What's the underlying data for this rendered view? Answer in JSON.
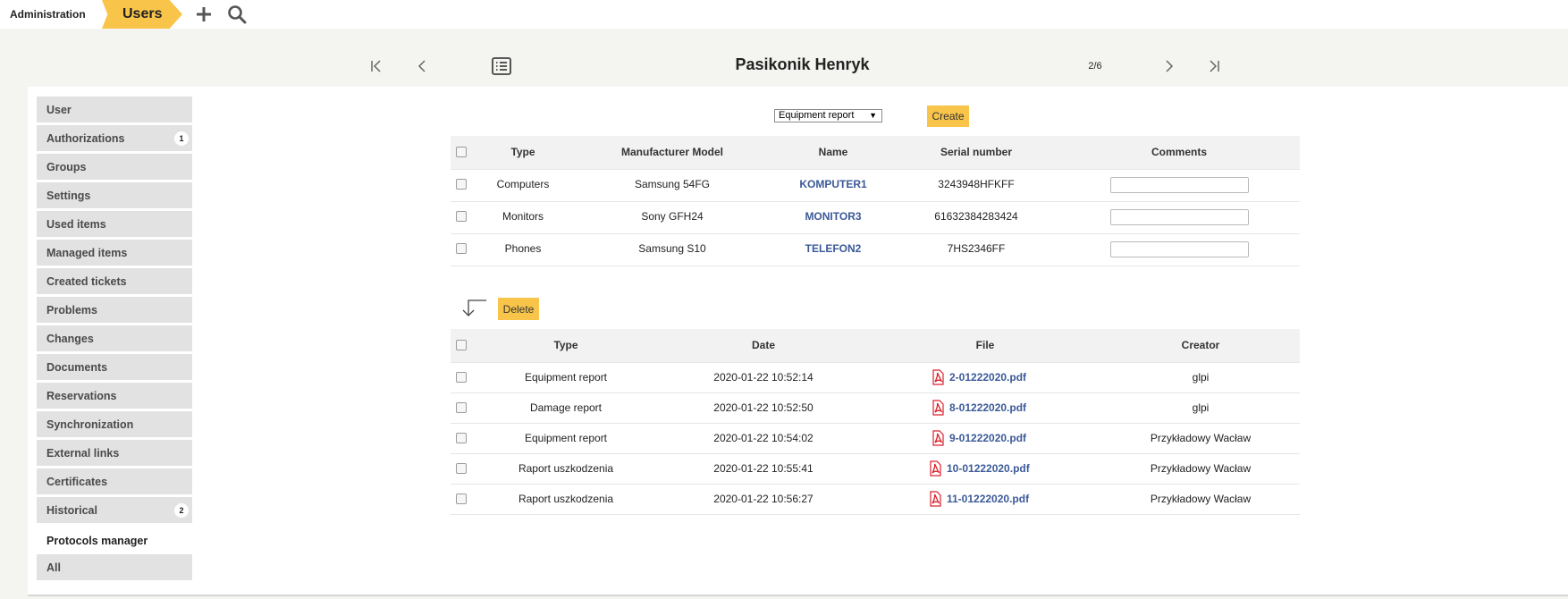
{
  "breadcrumb": {
    "root": "Administration",
    "current": "Users"
  },
  "icons": {
    "add": "plus-icon",
    "search": "search-icon",
    "first": "first-page-icon",
    "prev": "prev-page-icon",
    "list": "list-icon",
    "next": "next-page-icon",
    "last": "last-page-icon",
    "file": "pdf-icon"
  },
  "header": {
    "title": "Pasikonik Henryk",
    "pager": "2/6"
  },
  "sidebar": {
    "items": [
      {
        "label": "User",
        "badge": ""
      },
      {
        "label": "Authorizations",
        "badge": "1"
      },
      {
        "label": "Groups",
        "badge": ""
      },
      {
        "label": "Settings",
        "badge": ""
      },
      {
        "label": "Used items",
        "badge": ""
      },
      {
        "label": "Managed items",
        "badge": ""
      },
      {
        "label": "Created tickets",
        "badge": ""
      },
      {
        "label": "Problems",
        "badge": ""
      },
      {
        "label": "Changes",
        "badge": ""
      },
      {
        "label": "Documents",
        "badge": ""
      },
      {
        "label": "Reservations",
        "badge": ""
      },
      {
        "label": "Synchronization",
        "badge": ""
      },
      {
        "label": "External links",
        "badge": ""
      },
      {
        "label": "Certificates",
        "badge": ""
      },
      {
        "label": "Historical",
        "badge": "2"
      },
      {
        "label": "Protocols manager",
        "badge": ""
      },
      {
        "label": "All",
        "badge": ""
      }
    ],
    "active": "Protocols manager"
  },
  "create": {
    "select_value": "Equipment report",
    "button": "Create"
  },
  "items_table": {
    "headers": [
      "Type",
      "Manufacturer Model",
      "Name",
      "Serial number",
      "Comments"
    ],
    "rows": [
      {
        "type": "Computers",
        "model": "Samsung 54FG",
        "name": "KOMPUTER1",
        "serial": "3243948HFKFF",
        "comment": ""
      },
      {
        "type": "Monitors",
        "model": "Sony GFH24",
        "name": "MONITOR3",
        "serial": "61632384283424",
        "comment": ""
      },
      {
        "type": "Phones",
        "model": "Samsung S10",
        "name": "TELEFON2",
        "serial": "7HS2346FF",
        "comment": ""
      }
    ]
  },
  "delete_button": "Delete",
  "protocols_table": {
    "headers": [
      "Type",
      "Date",
      "File",
      "Creator"
    ],
    "rows": [
      {
        "type": "Equipment report",
        "date": "2020-01-22 10:52:14",
        "file": "2-01222020.pdf",
        "creator": "glpi"
      },
      {
        "type": "Damage report",
        "date": "2020-01-22 10:52:50",
        "file": "8-01222020.pdf",
        "creator": "glpi"
      },
      {
        "type": "Equipment report",
        "date": "2020-01-22 10:54:02",
        "file": "9-01222020.pdf",
        "creator": "Przykładowy Wacław"
      },
      {
        "type": "Raport uszkodzenia",
        "date": "2020-01-22 10:55:41",
        "file": "10-01222020.pdf",
        "creator": "Przykładowy Wacław"
      },
      {
        "type": "Raport uszkodzenia",
        "date": "2020-01-22 10:56:27",
        "file": "11-01222020.pdf",
        "creator": "Przykładowy Wacław"
      }
    ]
  },
  "colors": {
    "accent": "#f8c54a",
    "link": "#3b5998",
    "pdf": "#d9232d"
  }
}
